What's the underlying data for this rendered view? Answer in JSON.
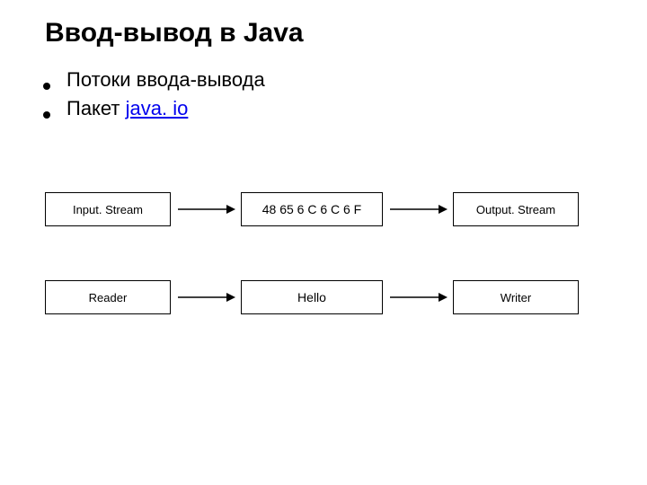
{
  "title": "Ввод-вывод в Java",
  "bullets": {
    "item1": "Потоки ввода-вывода",
    "item2_prefix": "Пакет ",
    "item2_link": "java. io"
  },
  "diagram": {
    "row1": {
      "left": "Input. Stream",
      "center": "48 65 6 C 6 C 6 F",
      "right": "Output. Stream"
    },
    "row2": {
      "left": "Reader",
      "center": "Hello",
      "right": "Writer"
    }
  }
}
